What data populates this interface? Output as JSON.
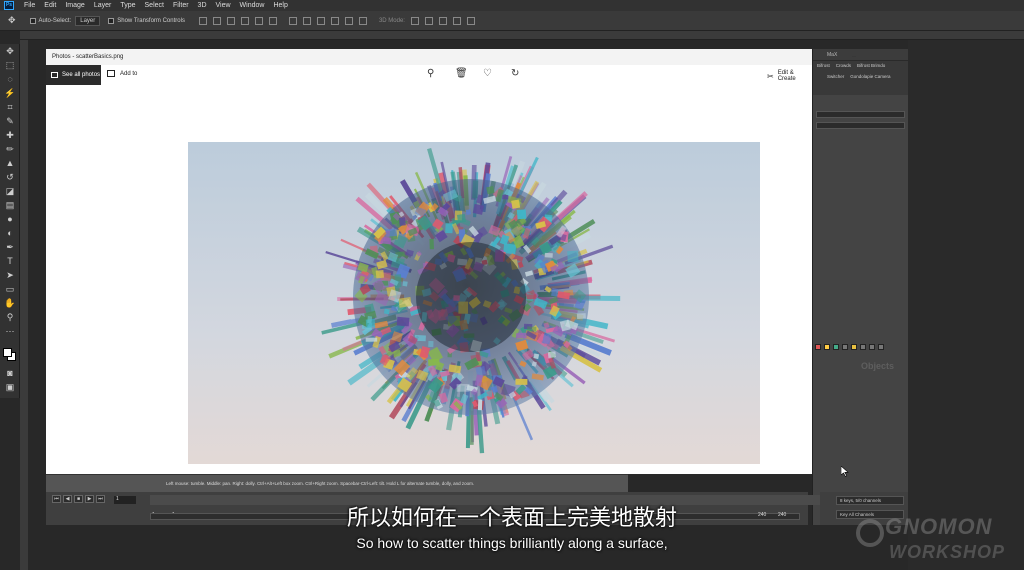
{
  "menubar": {
    "logo": "Ps",
    "items": [
      "File",
      "Edit",
      "Image",
      "Layer",
      "Type",
      "Select",
      "Filter",
      "3D",
      "View",
      "Window",
      "Help"
    ]
  },
  "options": {
    "auto_select": "Auto-Select:",
    "layer_value": "Layer",
    "show_transform": "Show Transform Controls",
    "mode3d": "3D Mode:"
  },
  "photos": {
    "title": "Photos - scatterBasics.png",
    "see_all": "See all photos",
    "add_to": "Add to",
    "edit_create": "Edit & Create"
  },
  "maya": {
    "panel_title": "MaX",
    "shelf_tabs": [
      "Bifrost",
      "Crowds",
      "Bifrost Brimdo"
    ],
    "shelf_items": [
      "Switcher",
      "Gondolapie Camera"
    ],
    "objects_label": "Objects",
    "help_text": "Left mouse: tumble. Middle: pan. Right: dolly. Ctrl+Alt+Left box zoom. Ctrl+Right zoom. Spacebar-Ctrl-Left: tilt. Hold L for alternate tumble, dolly, and zoom.",
    "current_frame": "1",
    "range_start": "1",
    "range_inner_start": "1",
    "range_end": "240",
    "range_inner_end": "240",
    "keys_field": "8 keys, 5/0 channels",
    "key_all": "Key All Channels"
  },
  "subtitles": {
    "chinese": "所以如何在一个表面上完美地散射",
    "english": "So how to scatter things brilliantly along a surface,"
  },
  "watermark": {
    "line1": "GNOMON",
    "line2": "WORKSHOP"
  },
  "colors": {
    "accent_ps": "#31a8ff"
  }
}
